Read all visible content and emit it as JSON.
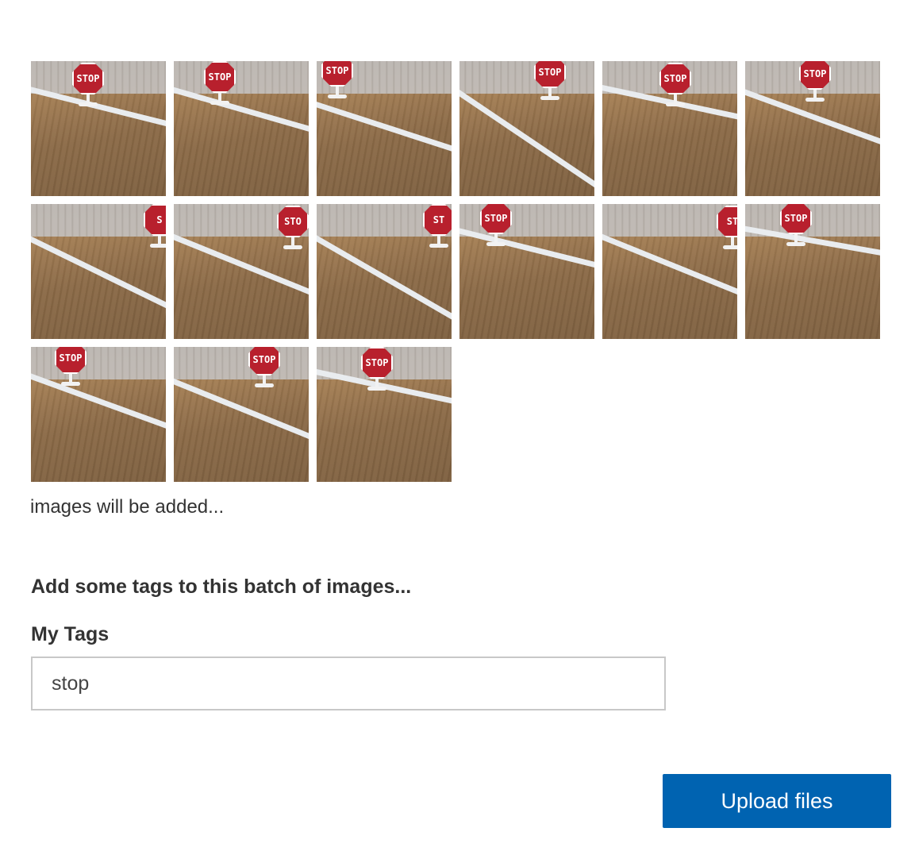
{
  "thumbnails": [
    {
      "alt": "stop sign image 1",
      "sign_text": "STOP"
    },
    {
      "alt": "stop sign image 2",
      "sign_text": "STOP"
    },
    {
      "alt": "stop sign image 3",
      "sign_text": "STOP"
    },
    {
      "alt": "stop sign image 4",
      "sign_text": "STOP"
    },
    {
      "alt": "stop sign image 5",
      "sign_text": "STOP"
    },
    {
      "alt": "stop sign image 6",
      "sign_text": "STOP"
    },
    {
      "alt": "stop sign image 7",
      "sign_text": "S"
    },
    {
      "alt": "stop sign image 8",
      "sign_text": "STO"
    },
    {
      "alt": "stop sign image 9",
      "sign_text": "ST"
    },
    {
      "alt": "stop sign image 10",
      "sign_text": "STOP"
    },
    {
      "alt": "stop sign image 11",
      "sign_text": "ST"
    },
    {
      "alt": "stop sign image 12",
      "sign_text": "STOP"
    },
    {
      "alt": "stop sign image 13",
      "sign_text": "STOP"
    },
    {
      "alt": "stop sign image 14",
      "sign_text": "STOP"
    },
    {
      "alt": "stop sign image 15",
      "sign_text": "STOP"
    }
  ],
  "status_text": "images will be added...",
  "tags": {
    "heading": "Add some tags to this batch of images...",
    "label": "My Tags",
    "value": "stop"
  },
  "upload_button_label": "Upload files",
  "colors": {
    "accent": "#0063b1",
    "stop_sign": "#b8202d"
  }
}
